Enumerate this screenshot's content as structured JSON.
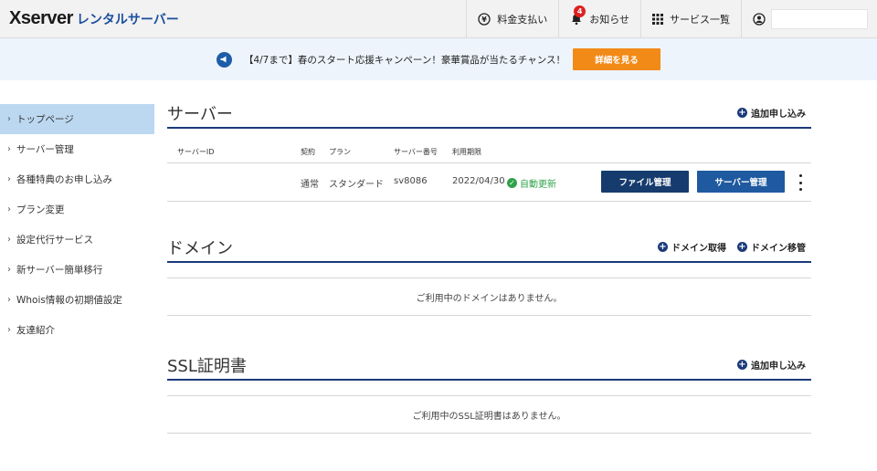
{
  "header": {
    "logo_main": "Xserver",
    "logo_sub": "レンタルサーバー",
    "nav": [
      {
        "label": "料金支払い",
        "icon": "yen-icon"
      },
      {
        "label": "お知らせ",
        "icon": "bell-icon",
        "badge": "4"
      },
      {
        "label": "サービス一覧",
        "icon": "grid-icon"
      },
      {
        "label": "",
        "icon": "user-icon"
      }
    ]
  },
  "banner": {
    "text": "【4/7まで】春のスタート応援キャンペーン！豪華賞品が当たるチャンス！",
    "button": "詳細を見る",
    "icon": "megaphone-icon"
  },
  "sidebar": {
    "items": [
      {
        "label": "トップページ",
        "active": true
      },
      {
        "label": "サーバー管理"
      },
      {
        "label": "各種特典のお申し込み"
      },
      {
        "label": "プラン変更"
      },
      {
        "label": "設定代行サービス"
      },
      {
        "label": "新サーバー簡単移行"
      },
      {
        "label": "Whois情報の初期値設定"
      },
      {
        "label": "友達紹介"
      }
    ]
  },
  "server": {
    "title": "サーバー",
    "action": "追加申し込み",
    "columns": {
      "id": "サーバーID",
      "contract": "契約",
      "plan": "プラン",
      "number": "サーバー番号",
      "expiry": "利用期限"
    },
    "row": {
      "id": "",
      "contract": "通常",
      "plan": "スタンダード",
      "number": "sv8086",
      "expiry": "2022/04/30",
      "auto": "自動更新",
      "btn_file": "ファイル管理",
      "btn_server": "サーバー管理"
    }
  },
  "domain": {
    "title": "ドメイン",
    "action1": "ドメイン取得",
    "action2": "ドメイン移管",
    "empty": "ご利用中のドメインはありません。"
  },
  "ssl": {
    "title": "SSL証明書",
    "action": "追加申し込み",
    "empty": "ご利用中のSSL証明書はありません。"
  },
  "colors": {
    "accent": "#1b3a7a",
    "banner_btn": "#f28a18",
    "active_side": "#bcd8f1",
    "success": "#2fa24a"
  }
}
